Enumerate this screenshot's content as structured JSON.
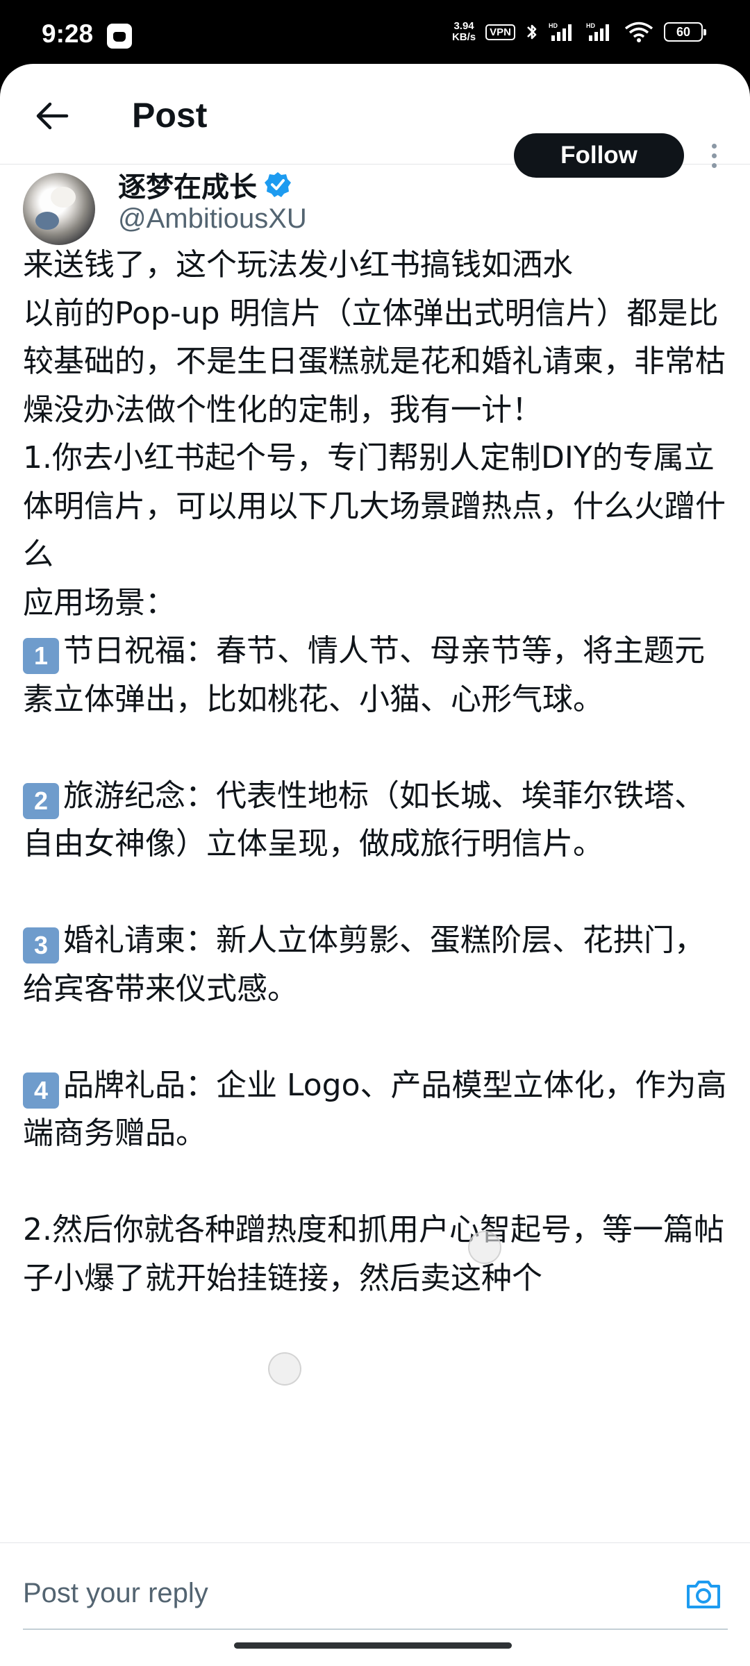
{
  "status_bar": {
    "time": "9:28",
    "speed_value": "3.94",
    "speed_unit": "KB/s",
    "vpn": "VPN",
    "battery": "60",
    "icons": [
      "app-notification-icon",
      "bluetooth-icon",
      "hd-signal-icon",
      "hd-signal-icon",
      "wifi-icon",
      "battery-icon"
    ]
  },
  "header": {
    "back_icon": "arrow-left-icon",
    "title": "Post"
  },
  "author": {
    "display_name": "逐梦在成长",
    "verified_icon": "verified-badge-icon",
    "handle": "@AmbitiousXU",
    "follow_label": "Follow",
    "more_icon": "more-vertical-icon"
  },
  "tweet": {
    "lines": [
      "来送钱了，这个玩法发小红书搞钱如洒水",
      "以前的Pop-up 明信片（立体弹出式明信片）都是比较基础的，不是生日蛋糕就是花和婚礼请柬，非常枯燥没办法做个性化的定制，我有一计！",
      "",
      "1.你去小红书起个号，专门帮别人定制DIY的专属立体明信片，可以用以下几大场景蹭热点，什么火蹭什么",
      "",
      "应用场景："
    ],
    "items": [
      {
        "num": "1",
        "text": "节日祝福：春节、情人节、母亲节等，将主题元素立体弹出，比如桃花、小猫、心形气球。"
      },
      {
        "num": "2",
        "text": "旅游纪念：代表性地标（如长城、埃菲尔铁塔、自由女神像）立体呈现，做成旅行明信片。"
      },
      {
        "num": "3",
        "text": "婚礼请柬：新人立体剪影、蛋糕阶层、花拱门，给宾客带来仪式感。"
      },
      {
        "num": "4",
        "text": "品牌礼品：企业 Logo、产品模型立体化，作为高端商务赠品。"
      }
    ],
    "tail": "2.然后你就各种蹭热度和抓用户心智起号，等一篇帖子小爆了就开始挂链接，然后卖这种个"
  },
  "reply": {
    "placeholder": "Post your reply",
    "camera_icon": "camera-icon"
  },
  "colors": {
    "follow_bg": "#0f1419",
    "accent": "#1d9bf0",
    "keycap": "#6f9ccc",
    "secondary_text": "#536471"
  }
}
